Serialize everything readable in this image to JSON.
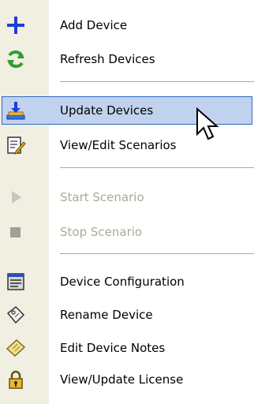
{
  "menu": {
    "items": [
      {
        "label": "Add Device",
        "icon": "plus-icon",
        "state": "normal"
      },
      {
        "label": "Refresh Devices",
        "icon": "refresh-icon",
        "state": "normal"
      },
      {
        "label": "Update Devices",
        "icon": "update-icon",
        "state": "highlighted"
      },
      {
        "label": "View/Edit Scenarios",
        "icon": "scenario-edit-icon",
        "state": "normal"
      },
      {
        "label": "Start Scenario",
        "icon": "play-icon",
        "state": "disabled"
      },
      {
        "label": "Stop Scenario",
        "icon": "stop-icon",
        "state": "disabled"
      },
      {
        "label": "Device Configuration",
        "icon": "configuration-icon",
        "state": "normal"
      },
      {
        "label": "Rename Device",
        "icon": "rename-tag-icon",
        "state": "normal"
      },
      {
        "label": "Edit Device Notes",
        "icon": "notes-icon",
        "state": "normal"
      },
      {
        "label": "View/Update License",
        "icon": "license-lock-icon",
        "state": "normal"
      }
    ]
  },
  "colors": {
    "highlight_bg": "#c1d2ee",
    "highlight_border": "#316ac5",
    "gutter": "#f1efe2",
    "disabled_text": "#aca899",
    "plus_blue": "#1b3ed6",
    "refresh_green": "#2f9e2f"
  }
}
